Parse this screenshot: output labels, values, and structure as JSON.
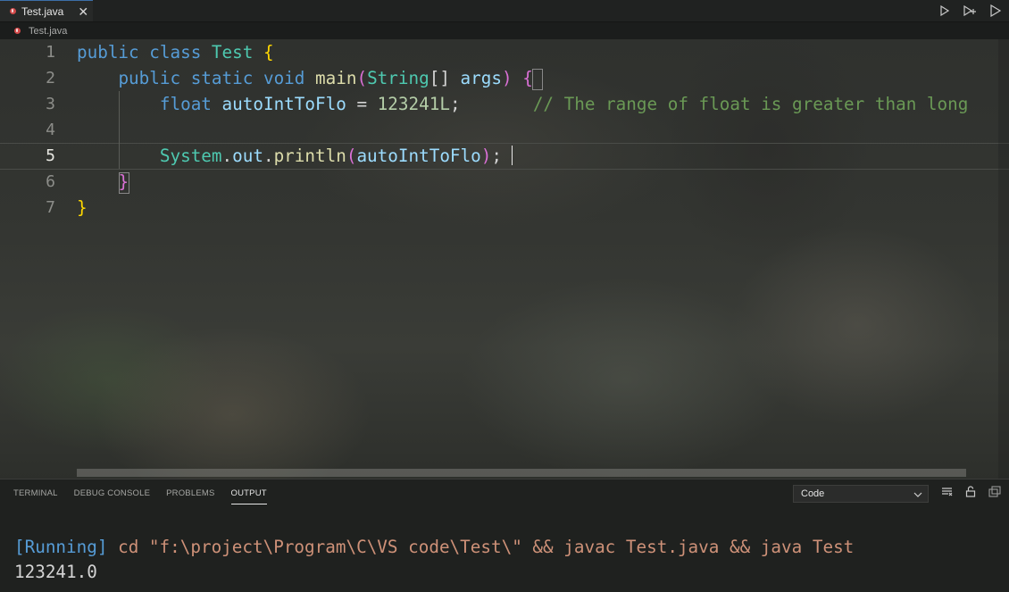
{
  "tabs": [
    {
      "label": "Test.java",
      "close": "✕",
      "icon": "java-file-icon"
    }
  ],
  "toolbar": {
    "icons": [
      "run-icon",
      "run-split-icon",
      "run-outline-icon"
    ]
  },
  "breadcrumb": {
    "file": "Test.java"
  },
  "editor": {
    "line_numbers": [
      "1",
      "2",
      "3",
      "4",
      "5",
      "6",
      "7"
    ],
    "active_line": 5,
    "lines": {
      "l1": {
        "kw1": "public",
        "kw2": "class",
        "cls": "Test",
        "brace": "{"
      },
      "l2": {
        "kw1": "public",
        "kw2": "static",
        "kw3": "void",
        "fn": "main",
        "po": "(",
        "cls": "String",
        "arr": "[]",
        "var": "args",
        "pc": ")",
        "brace": "{"
      },
      "l3": {
        "kw": "float",
        "var": "autoIntToFlo",
        "eq": "=",
        "num": "123241L",
        "semi": ";",
        "cmt": "// The range of float is greater than long"
      },
      "l5": {
        "cls": "System",
        "dot1": ".",
        "var": "out",
        "dot2": ".",
        "fn": "println",
        "po": "(",
        "arg": "autoIntToFlo",
        "pc": ")",
        "semi": ";"
      },
      "l6": {
        "brace": "}"
      },
      "l7": {
        "brace": "}"
      }
    }
  },
  "panel": {
    "tabs": [
      "TERMINAL",
      "DEBUG CONSOLE",
      "PROBLEMS",
      "OUTPUT"
    ],
    "active_tab": "OUTPUT",
    "output_source": "Code",
    "icons": [
      "clear-output-icon",
      "lock-icon",
      "copy-icon"
    ],
    "output": {
      "running": "[Running]",
      "command": "cd \"f:\\project\\Program\\C\\VS code\\Test\\\" && javac Test.java && java Test",
      "result": "123241.0"
    }
  },
  "colors": {
    "keyword": "#569cd6",
    "class": "#4ec9b0",
    "function": "#dcdcaa",
    "variable": "#9cdcfe",
    "number": "#b5cea8",
    "comment": "#6a9955",
    "string": "#ce9178"
  }
}
